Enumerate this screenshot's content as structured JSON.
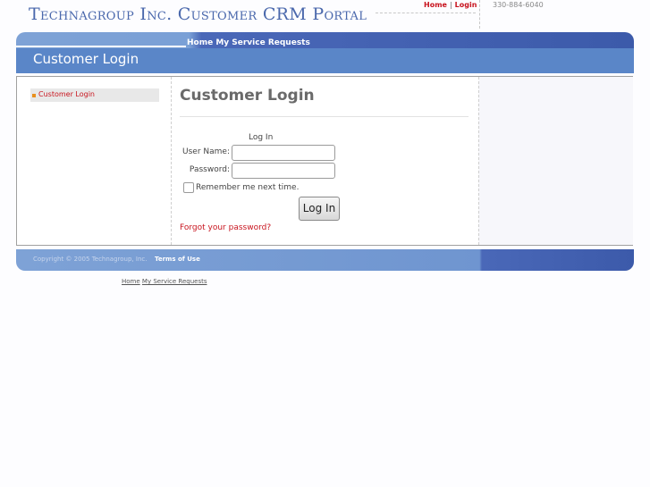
{
  "header": {
    "site_title": "Technagroup Inc. Customer CRM Portal",
    "links": [
      "Home",
      "Login"
    ],
    "separator": "|",
    "phone": "330-884-6040"
  },
  "nav": {
    "links": "Home My Service Requests"
  },
  "page": {
    "title_bar": "Customer Login"
  },
  "sidebar": {
    "items": [
      {
        "label": "Customer Login"
      }
    ]
  },
  "main": {
    "heading": "Customer Login",
    "form": {
      "caption": "Log In",
      "username_label": "User Name:",
      "username_value": "",
      "password_label": "Password:",
      "password_value": "",
      "remember_label": "Remember me next time.",
      "remember_checked": false,
      "submit_label": "Log In",
      "forgot_link": "Forgot your password?"
    }
  },
  "footer": {
    "copyright": "Copyright © 2005 Technagroup, Inc.",
    "terms": "Terms of Use",
    "bottom_links": [
      "Home",
      "My Service Requests"
    ]
  },
  "colors": {
    "brand_blue": "#4a68ac",
    "link_red": "#c8141e",
    "bar_light": "#7ea2d6",
    "bar_dark": "#3c5aaa"
  }
}
